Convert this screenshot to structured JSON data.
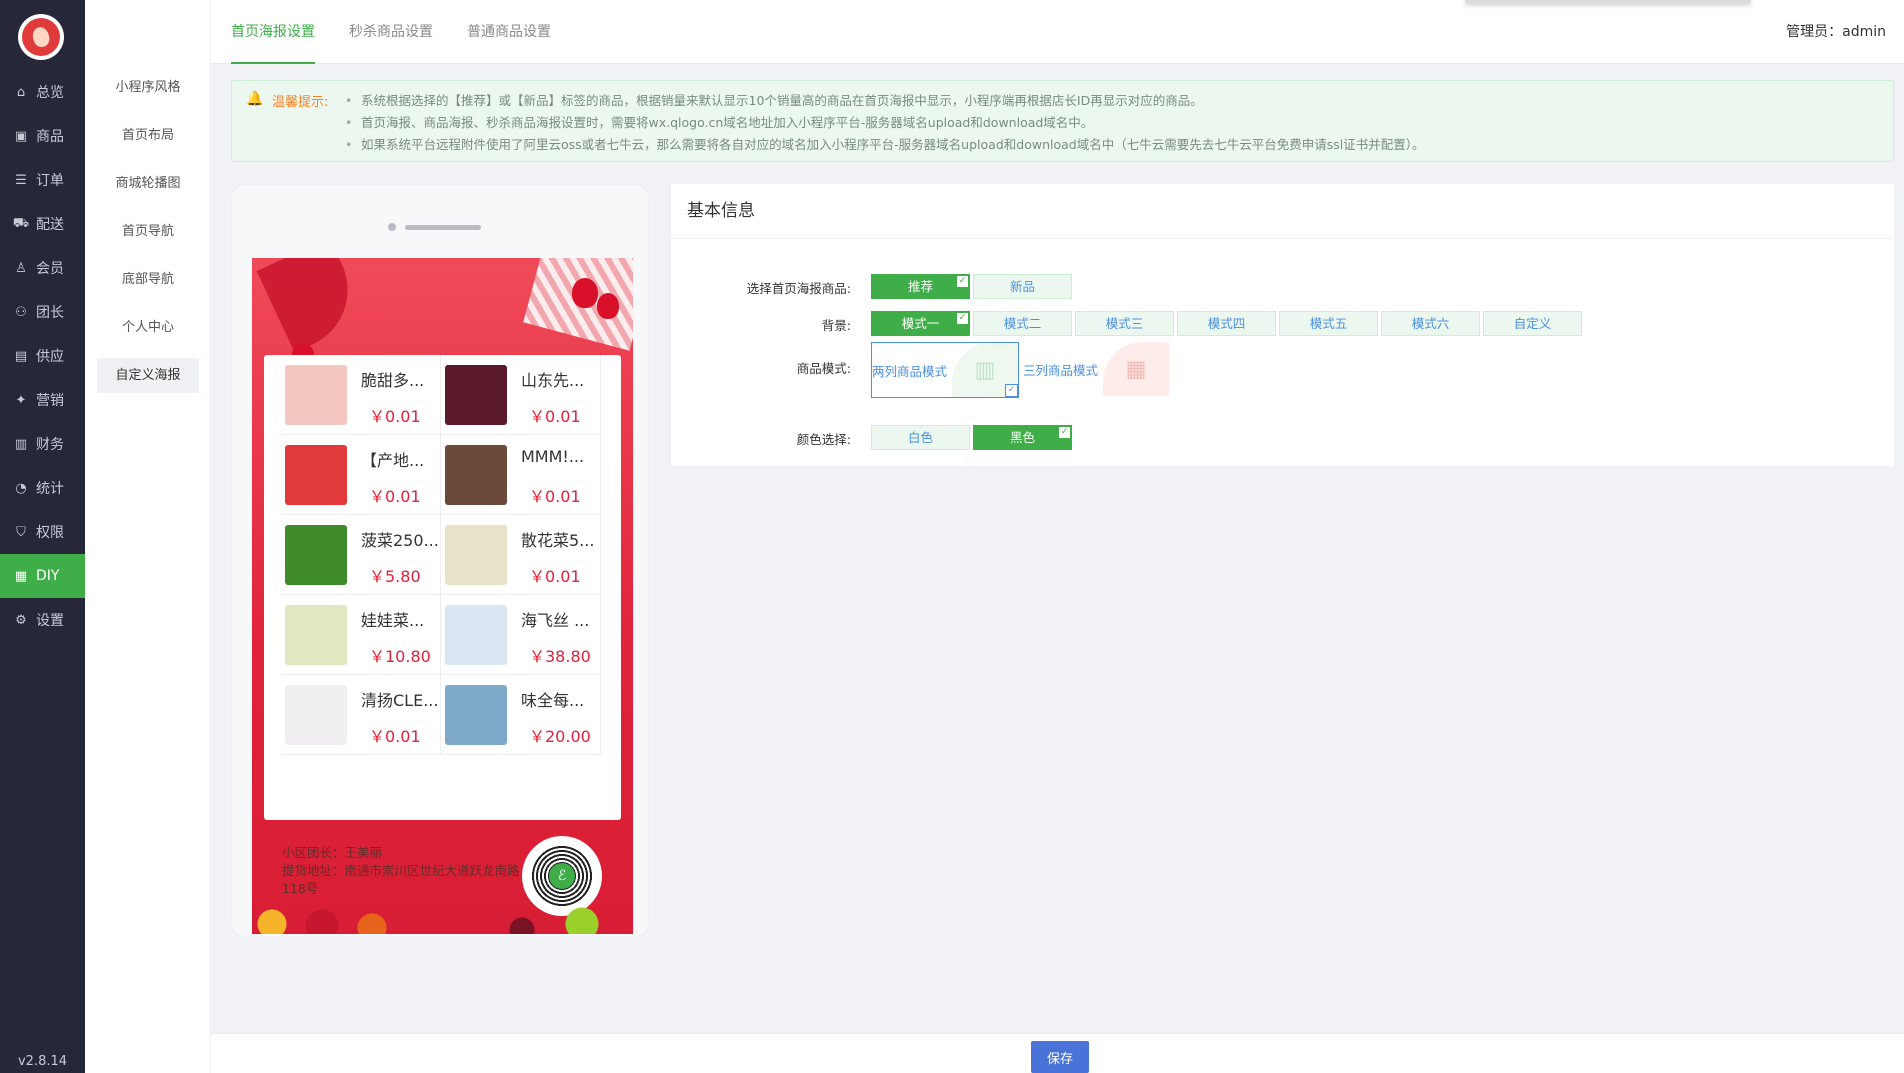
{
  "sidebar": {
    "items": [
      {
        "label": "总览",
        "icon": "home-icon",
        "glyph": "⌂"
      },
      {
        "label": "商品",
        "icon": "shop-icon",
        "glyph": "▣"
      },
      {
        "label": "订单",
        "icon": "order-icon",
        "glyph": "☰"
      },
      {
        "label": "配送",
        "icon": "delivery-icon",
        "glyph": "⛟"
      },
      {
        "label": "会员",
        "icon": "user-icon",
        "glyph": "♙"
      },
      {
        "label": "团长",
        "icon": "leader-icon",
        "glyph": "⚇"
      },
      {
        "label": "供应",
        "icon": "supply-icon",
        "glyph": "▤"
      },
      {
        "label": "营销",
        "icon": "gift-icon",
        "glyph": "✦"
      },
      {
        "label": "财务",
        "icon": "finance-icon",
        "glyph": "▥"
      },
      {
        "label": "统计",
        "icon": "chart-icon",
        "glyph": "◔"
      },
      {
        "label": "权限",
        "icon": "shield-icon",
        "glyph": "⛉"
      },
      {
        "label": "DIY",
        "icon": "diy-icon",
        "glyph": "▦"
      },
      {
        "label": "设置",
        "icon": "gear-icon",
        "glyph": "⚙"
      }
    ],
    "active_index": 11,
    "version": "v2.8.14"
  },
  "subnav": {
    "items": [
      "小程序风格",
      "首页布局",
      "商城轮播图",
      "首页导航",
      "底部导航",
      "个人中心",
      "自定义海报"
    ],
    "active_index": 6
  },
  "tabs": [
    "首页海报设置",
    "秒杀商品设置",
    "普通商品设置"
  ],
  "admin": {
    "label": "管理员：",
    "name": "admin"
  },
  "notice": {
    "title": "温馨提示:",
    "items": [
      "系统根据选择的【推荐】或【新品】标签的商品，根据销量来默认显示10个销量高的商品在首页海报中显示，小程序端再根据店长ID再显示对应的商品。",
      "首页海报、商品海报、秒杀商品海报设置时，需要将wx.qlogo.cn域名地址加入小程序平台-服务器域名upload和download域名中。",
      "如果系统平台远程附件使用了阿里云oss或者七牛云，那么需要将各自对应的域名加入小程序平台-服务器域名upload和download域名中（七牛云需要先去七牛云平台免费申请ssl证书并配置）。"
    ]
  },
  "poster": {
    "products": [
      {
        "name": "脆甜多...",
        "price": "￥0.01",
        "color": "#f3c6c0"
      },
      {
        "name": "山东先...",
        "price": "￥0.01",
        "color": "#5a1a2a"
      },
      {
        "name": "【产地...",
        "price": "￥0.01",
        "color": "#e23a3a"
      },
      {
        "name": "MMM!...",
        "price": "￥0.01",
        "color": "#6b4a3a"
      },
      {
        "name": "菠菜250...",
        "price": "￥5.80",
        "color": "#3f8a2a"
      },
      {
        "name": "散花菜5...",
        "price": "￥0.01",
        "color": "#e8e2c8"
      },
      {
        "name": "娃娃菜...",
        "price": "￥10.80",
        "color": "#dfe8c0"
      },
      {
        "name": "海飞丝 ...",
        "price": "￥38.80",
        "color": "#d9e6f2"
      },
      {
        "name": "清扬CLE...",
        "price": "￥0.01",
        "color": "#f0eef0"
      },
      {
        "name": "味全每...",
        "price": "￥20.00",
        "color": "#7fa9c8"
      }
    ],
    "leader": "小区团长：王美丽",
    "address": "提货地址：南通市崇川区世纪大道跃龙南路118号"
  },
  "form": {
    "title": "基本信息",
    "product_label": "选择首页海报商品:",
    "product_options": [
      "推荐",
      "新品"
    ],
    "product_selected": 0,
    "bg_label": "背景:",
    "bg_options": [
      "模式一",
      "模式二",
      "模式三",
      "模式四",
      "模式五",
      "模式六",
      "自定义"
    ],
    "bg_selected": 0,
    "mode_label": "商品模式:",
    "mode_options": [
      "两列商品模式",
      "三列商品模式"
    ],
    "mode_selected": 0,
    "color_label": "颜色选择:",
    "color_options": [
      "白色",
      "黑色"
    ],
    "color_selected": 1
  },
  "save_label": "保存",
  "colors": {
    "accent": "#3fae48",
    "primary": "#4a73d9",
    "price": "#e0223a",
    "sidebar": "#26283a"
  }
}
